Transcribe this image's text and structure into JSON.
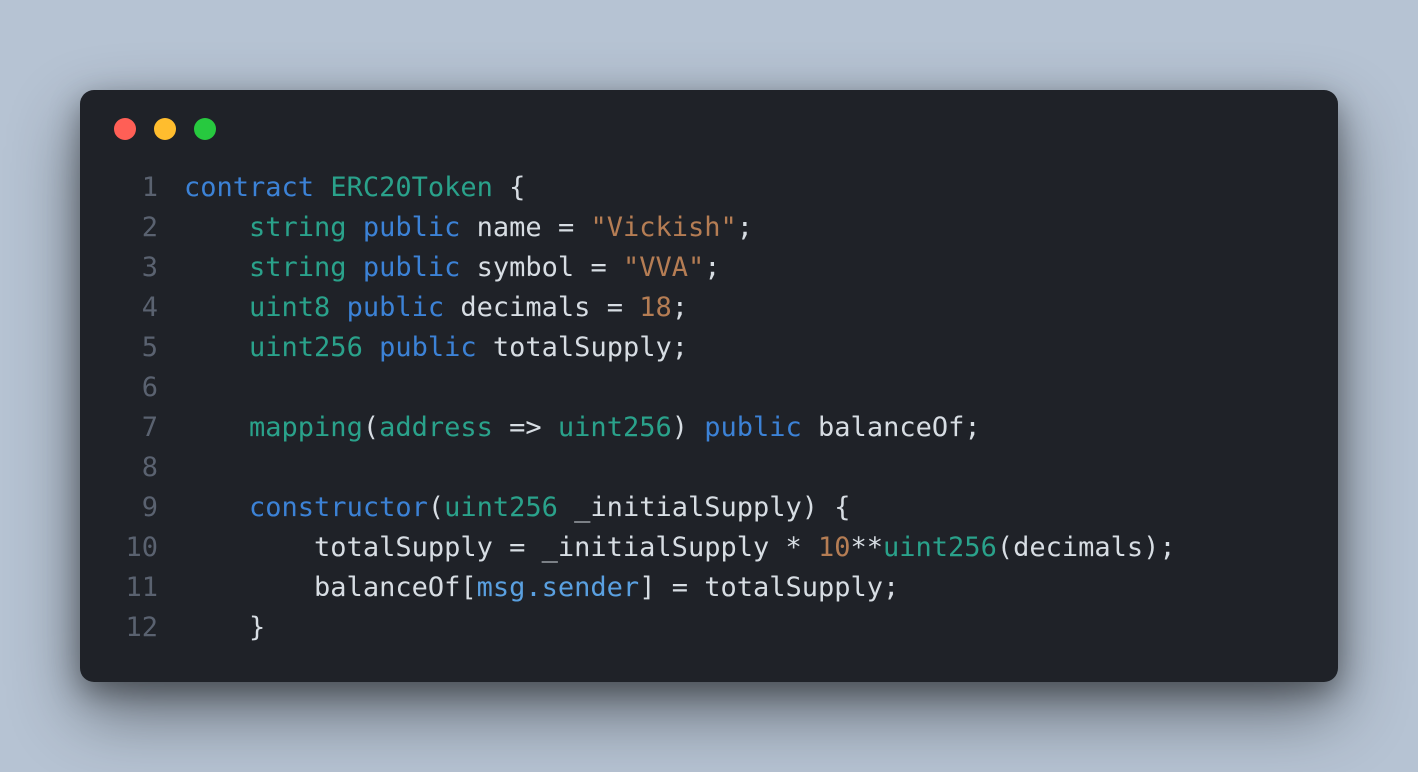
{
  "window": {
    "buttons": [
      "close",
      "minimize",
      "maximize"
    ]
  },
  "code": {
    "language": "solidity",
    "lines": [
      {
        "n": "1",
        "indent": "",
        "tokens": [
          [
            "kw",
            "contract"
          ],
          [
            "pn",
            " "
          ],
          [
            "type",
            "ERC20Token"
          ],
          [
            "pn",
            " {"
          ]
        ]
      },
      {
        "n": "2",
        "indent": "    ",
        "tokens": [
          [
            "type",
            "string"
          ],
          [
            "pn",
            " "
          ],
          [
            "kw",
            "public"
          ],
          [
            "pn",
            " "
          ],
          [
            "id",
            "name"
          ],
          [
            "pn",
            " = "
          ],
          [
            "str",
            "\"Vickish\""
          ],
          [
            "pn",
            ";"
          ]
        ]
      },
      {
        "n": "3",
        "indent": "    ",
        "tokens": [
          [
            "type",
            "string"
          ],
          [
            "pn",
            " "
          ],
          [
            "kw",
            "public"
          ],
          [
            "pn",
            " "
          ],
          [
            "id",
            "symbol"
          ],
          [
            "pn",
            " = "
          ],
          [
            "str",
            "\"VVA\""
          ],
          [
            "pn",
            ";"
          ]
        ]
      },
      {
        "n": "4",
        "indent": "    ",
        "tokens": [
          [
            "type",
            "uint8"
          ],
          [
            "pn",
            " "
          ],
          [
            "kw",
            "public"
          ],
          [
            "pn",
            " "
          ],
          [
            "id",
            "decimals"
          ],
          [
            "pn",
            " = "
          ],
          [
            "num",
            "18"
          ],
          [
            "pn",
            ";"
          ]
        ]
      },
      {
        "n": "5",
        "indent": "    ",
        "tokens": [
          [
            "type",
            "uint256"
          ],
          [
            "pn",
            " "
          ],
          [
            "kw",
            "public"
          ],
          [
            "pn",
            " "
          ],
          [
            "id",
            "totalSupply"
          ],
          [
            "pn",
            ";"
          ]
        ]
      },
      {
        "n": "6",
        "indent": "",
        "tokens": []
      },
      {
        "n": "7",
        "indent": "    ",
        "tokens": [
          [
            "fn",
            "mapping"
          ],
          [
            "pn",
            "("
          ],
          [
            "type",
            "address"
          ],
          [
            "pn",
            " => "
          ],
          [
            "type",
            "uint256"
          ],
          [
            "pn",
            ") "
          ],
          [
            "kw",
            "public"
          ],
          [
            "pn",
            " "
          ],
          [
            "id",
            "balanceOf"
          ],
          [
            "pn",
            ";"
          ]
        ]
      },
      {
        "n": "8",
        "indent": "",
        "tokens": []
      },
      {
        "n": "9",
        "indent": "    ",
        "tokens": [
          [
            "kw",
            "constructor"
          ],
          [
            "pn",
            "("
          ],
          [
            "type",
            "uint256"
          ],
          [
            "pn",
            " "
          ],
          [
            "id",
            "_initialSupply"
          ],
          [
            "pn",
            ") {"
          ]
        ]
      },
      {
        "n": "10",
        "indent": "        ",
        "tokens": [
          [
            "id",
            "totalSupply"
          ],
          [
            "pn",
            " = "
          ],
          [
            "id",
            "_initialSupply"
          ],
          [
            "pn",
            " * "
          ],
          [
            "num",
            "10"
          ],
          [
            "pn",
            "**"
          ],
          [
            "type",
            "uint256"
          ],
          [
            "pn",
            "("
          ],
          [
            "id",
            "decimals"
          ],
          [
            "pn",
            ");"
          ]
        ]
      },
      {
        "n": "11",
        "indent": "        ",
        "tokens": [
          [
            "id",
            "balanceOf"
          ],
          [
            "pn",
            "["
          ],
          [
            "prop",
            "msg.sender"
          ],
          [
            "pn",
            "] = "
          ],
          [
            "id",
            "totalSupply"
          ],
          [
            "pn",
            ";"
          ]
        ]
      },
      {
        "n": "12",
        "indent": "    ",
        "tokens": [
          [
            "pn",
            "}"
          ]
        ]
      }
    ]
  }
}
